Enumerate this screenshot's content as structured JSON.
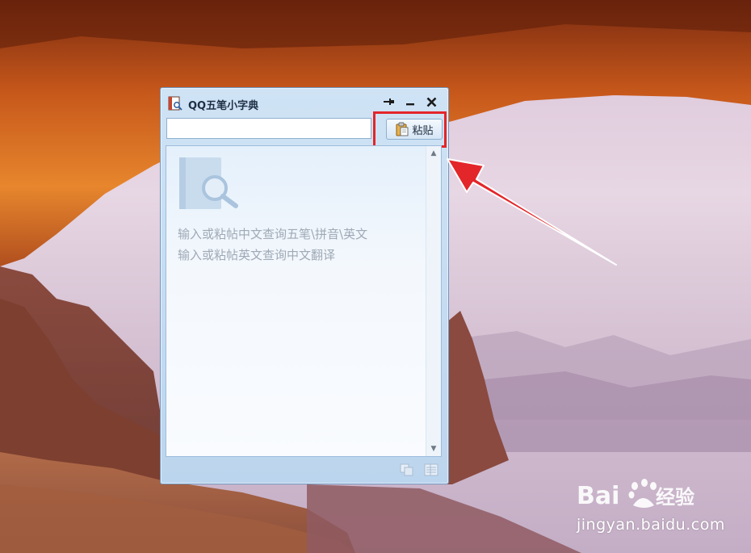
{
  "window": {
    "title": "QQ五笔小字典",
    "title_buttons": {
      "pin": "pin",
      "minimize": "minimize",
      "close": "close"
    }
  },
  "search": {
    "value": "",
    "placeholder": ""
  },
  "paste_button": {
    "label": "粘贴",
    "icon": "clipboard-icon"
  },
  "content": {
    "hint_lines": [
      "输入或粘帖中文查询五笔\\拼音\\英文",
      "输入或粘帖英文查询中文翻译"
    ],
    "icon": "book-search-icon"
  },
  "footer_icons": [
    "copy-icon",
    "list-icon"
  ],
  "annotation": {
    "highlight_color": "#e3262a",
    "arrow_color": "#e3262a"
  },
  "watermark": {
    "brand": "Bai du 经验",
    "url": "jingyan.baidu.com"
  }
}
